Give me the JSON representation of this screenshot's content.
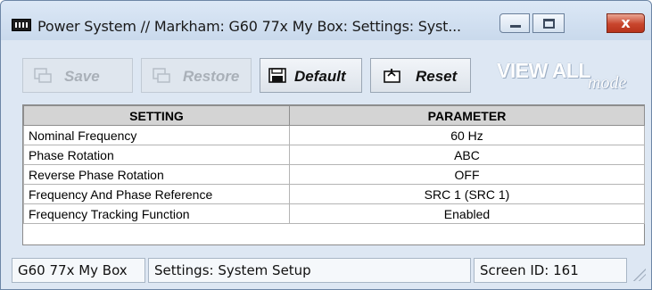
{
  "window": {
    "title": "Power System // Markham: G60 77x My Box: Settings: Syst...",
    "close_label": "x"
  },
  "toolbar": {
    "save_label": "Save",
    "restore_label": "Restore",
    "default_label": "Default",
    "reset_label": "Reset",
    "mode_label_big": "VIEW ALL",
    "mode_label_small": "mode"
  },
  "table": {
    "headers": [
      "SETTING",
      "PARAMETER"
    ],
    "rows": [
      {
        "setting": "Nominal Frequency",
        "parameter": "60 Hz"
      },
      {
        "setting": "Phase Rotation",
        "parameter": "ABC"
      },
      {
        "setting": "Reverse Phase Rotation",
        "parameter": "OFF"
      },
      {
        "setting": "Frequency And Phase Reference",
        "parameter": "SRC 1 (SRC 1)"
      },
      {
        "setting": "Frequency Tracking Function",
        "parameter": "Enabled"
      }
    ]
  },
  "statusbar": {
    "device": "G60 77x My Box",
    "section": "Settings: System Setup",
    "screen_id": "Screen ID: 161"
  },
  "icons": {
    "app": "device-terminal-icon",
    "save": "save-disk-icon",
    "restore": "restore-icon",
    "default": "default-disk-icon",
    "reset": "reset-icon"
  },
  "colors": {
    "window_bg": "#dde7f3",
    "header_bg": "#d4d4d4",
    "close_button": "#c8452c"
  }
}
